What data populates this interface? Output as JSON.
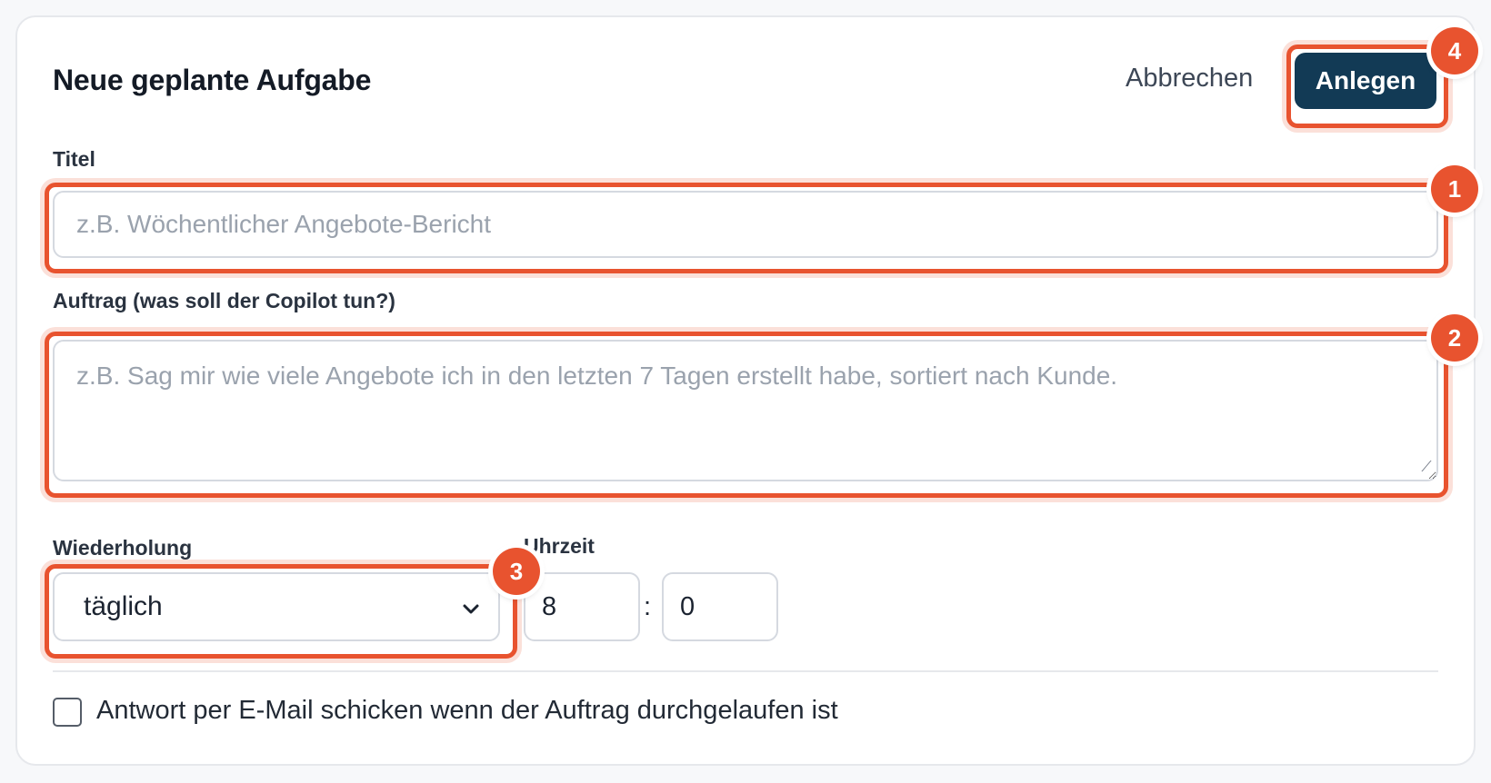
{
  "dialog": {
    "title": "Neue geplante Aufgabe",
    "cancel_label": "Abbrechen",
    "create_label": "Anlegen"
  },
  "form": {
    "titel": {
      "label": "Titel",
      "placeholder": "z.B. Wöchentlicher Angebote-Bericht",
      "value": ""
    },
    "auftrag": {
      "label": "Auftrag (was soll der Copilot tun?)",
      "placeholder": "z.B. Sag mir wie viele Angebote ich in den letzten 7 Tagen erstellt habe, sortiert nach Kunde.",
      "value": ""
    },
    "wiederholung": {
      "label": "Wiederholung",
      "selected": "täglich"
    },
    "uhrzeit": {
      "label": "Uhrzeit",
      "hour": "8",
      "separator": ":",
      "minute": "0"
    },
    "email_checkbox": {
      "label": "Antwort per E-Mail schicken wenn der Auftrag durchgelaufen ist",
      "checked": false
    }
  },
  "annotations": {
    "color": "#e8532f",
    "badges": [
      "1",
      "2",
      "3",
      "4"
    ]
  },
  "colors": {
    "primary": "#123a55",
    "border": "#d5d9e0",
    "background": "#f7f8fa"
  }
}
